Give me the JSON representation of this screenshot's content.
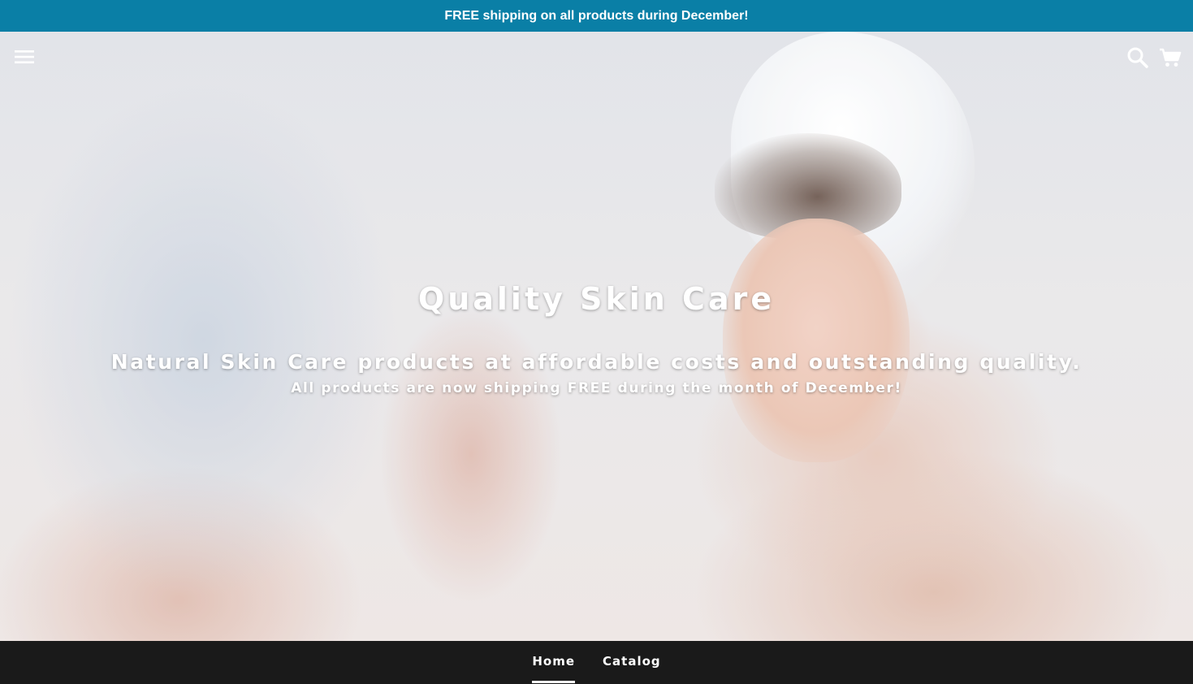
{
  "announcement": {
    "text": "FREE shipping on all products during December!"
  },
  "header": {
    "icons": [
      "hamburger-menu-icon",
      "search-icon",
      "cart-icon"
    ]
  },
  "hero": {
    "title": "Quality Skin Care",
    "subtitle": "Natural Skin Care products at affordable costs and outstanding quality.",
    "note": "All products are now shipping FREE during the month of December!"
  },
  "nav": {
    "items": [
      {
        "label": "Home",
        "active": true
      },
      {
        "label": "Catalog",
        "active": false
      }
    ]
  },
  "colors": {
    "announcement_bg": "#0a7fa6",
    "nav_bg": "#1a1a1a",
    "text": "#ffffff"
  }
}
